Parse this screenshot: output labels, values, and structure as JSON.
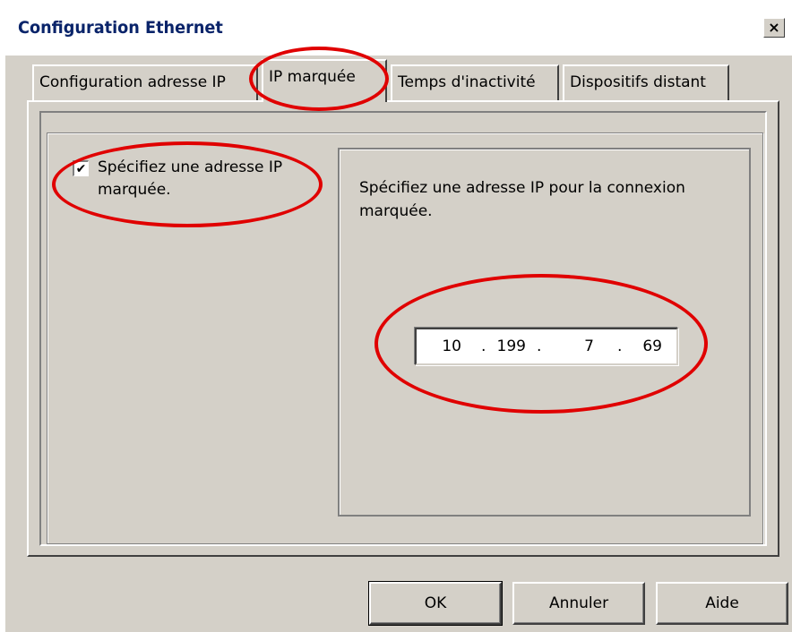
{
  "window": {
    "title": "Configuration Ethernet",
    "close_glyph": "×"
  },
  "tabs": [
    {
      "label": "Configuration adresse IP",
      "active": false
    },
    {
      "label": "IP marquée",
      "active": true
    },
    {
      "label": "Temps d'inactivité",
      "active": false
    },
    {
      "label": "Dispositifs distant",
      "active": false
    }
  ],
  "checkbox": {
    "label": "Spécifiez une adresse IP marquée.",
    "checked": true,
    "check_glyph": "✔"
  },
  "panel": {
    "description": "Spécifiez une adresse IP pour la connexion marquée."
  },
  "ip": {
    "octets": [
      "10",
      "199",
      "7",
      "69"
    ],
    "separator": "."
  },
  "buttons": {
    "ok": "OK",
    "cancel": "Annuler",
    "help": "Aide"
  },
  "colors": {
    "face": "#d4d0c8",
    "title_text": "#0a246a",
    "annotation": "#e00000"
  }
}
